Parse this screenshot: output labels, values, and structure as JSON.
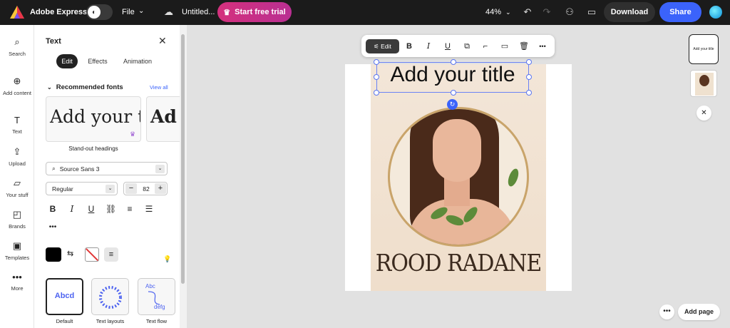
{
  "topbar": {
    "app_name": "Adobe Express",
    "file_label": "File",
    "doc_title": "Untitled...",
    "trial_label": "Start free trial",
    "zoom": "44%",
    "download_label": "Download",
    "share_label": "Share"
  },
  "rail": [
    {
      "label": "Search",
      "icon": "search-icon"
    },
    {
      "label": "Add content",
      "icon": "plus-icon"
    },
    {
      "label": "Text",
      "icon": "text-icon"
    },
    {
      "label": "Upload",
      "icon": "upload-icon"
    },
    {
      "label": "Your stuff",
      "icon": "folder-icon"
    },
    {
      "label": "Brands",
      "icon": "brand-icon"
    },
    {
      "label": "Templates",
      "icon": "templates-icon"
    },
    {
      "label": "More",
      "icon": "more-icon"
    }
  ],
  "panel": {
    "title": "Text",
    "tabs": [
      "Edit",
      "Effects",
      "Animation"
    ],
    "recommended_label": "Recommended fonts",
    "view_all": "View all",
    "font_preview_1": "Add your title",
    "font_preview_2": "Ad",
    "font_caption": "Stand-out headings",
    "font_family": "Source Sans 3",
    "font_weight": "Regular",
    "font_size": "82",
    "text_color": "#000000",
    "layouts": [
      {
        "label": "Default",
        "preview": "Abcd"
      },
      {
        "label": "Text layouts",
        "preview": "ABCDEFGHIJK"
      },
      {
        "label": "Text flow",
        "preview_top": "Abc",
        "preview_bottom": "defg"
      }
    ]
  },
  "toolbar": {
    "edit_label": "Edit"
  },
  "canvas": {
    "title_text": "Add your title",
    "brand_text": "ROOD RADANE"
  },
  "pages": {
    "thumb1_text": "Add your title",
    "add_page_label": "Add page"
  },
  "colors": {
    "accent": "#3b63fb",
    "trial_gradient_start": "#d4317d",
    "topbar_bg": "#1b1b1b"
  }
}
